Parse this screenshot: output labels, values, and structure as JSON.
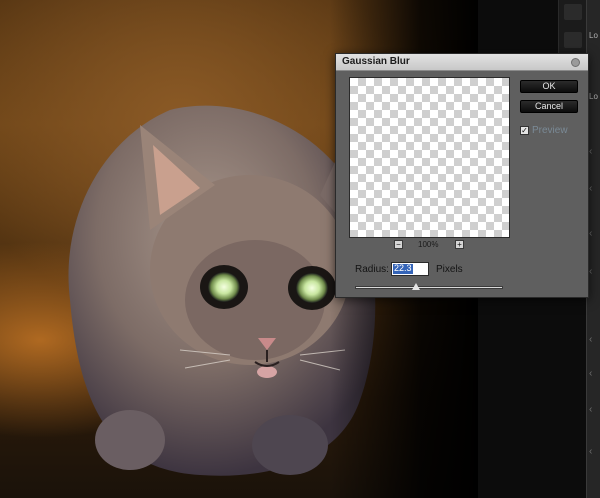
{
  "dialog": {
    "title": "Gaussian Blur",
    "ok_label": "OK",
    "cancel_label": "Cancel",
    "preview_label": "Preview",
    "preview_checked": true,
    "zoom_minus": "−",
    "zoom_plus": "+",
    "zoom_level": "100%",
    "radius_label": "Radius:",
    "radius_value": "22.3",
    "radius_unit": "Pixels",
    "slider_fraction": 0.41
  },
  "side_panel": {
    "tabs": [
      "Lo",
      "Lo",
      "B"
    ]
  },
  "colors": {
    "dialog_bg": "#5f5f5f",
    "button_bg": "#111111",
    "selection": "#3464b8"
  }
}
